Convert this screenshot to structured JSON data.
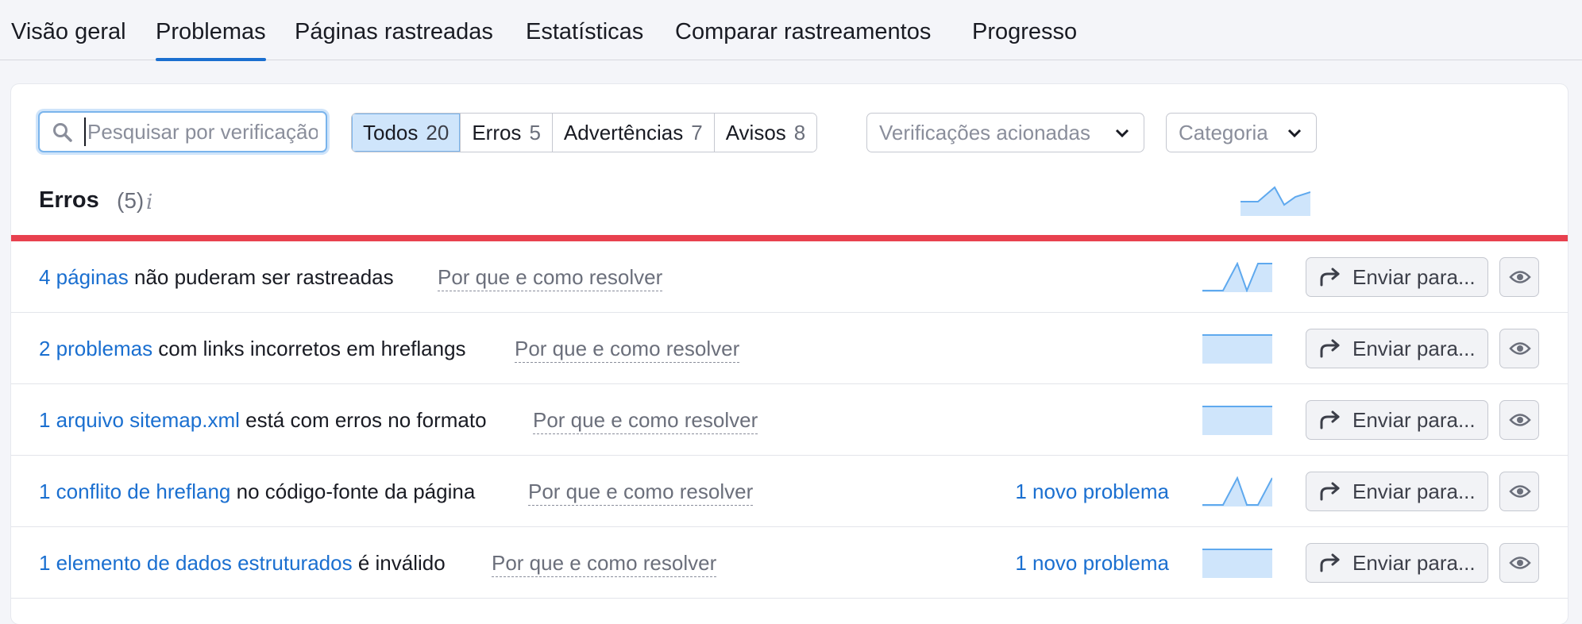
{
  "tabs": [
    {
      "label": "Visão geral",
      "active": false
    },
    {
      "label": "Problemas",
      "active": true
    },
    {
      "label": "Páginas rastreadas",
      "active": false
    },
    {
      "label": "Estatísticas",
      "active": false
    },
    {
      "label": "Comparar rastreamentos",
      "active": false
    },
    {
      "label": "Progresso",
      "active": false
    }
  ],
  "search": {
    "placeholder": "Pesquisar por verificação",
    "value": ""
  },
  "filters": [
    {
      "label": "Todos",
      "count": "20",
      "active": true
    },
    {
      "label": "Erros",
      "count": "5",
      "active": false
    },
    {
      "label": "Advertências",
      "count": "7",
      "active": false
    },
    {
      "label": "Avisos",
      "count": "8",
      "active": false
    }
  ],
  "dropdowns": {
    "checks": "Verificações acionadas",
    "category": "Categoria"
  },
  "section": {
    "title": "Erros",
    "count": "(5)",
    "info_icon": "i"
  },
  "colors": {
    "accent": "#1a6fd0",
    "error": "#e8414f",
    "spark_fill": "#cfe5fb",
    "spark_line": "#5fa9ee"
  },
  "why_label": "Por que e como resolver",
  "send_label": "Enviar para...",
  "rows": [
    {
      "link": "4 páginas",
      "text": " não puderam ser rastreadas",
      "new": ""
    },
    {
      "link": "2 problemas",
      "text": " com links incorretos em hreflangs",
      "new": ""
    },
    {
      "link": "1 arquivo sitemap.xml",
      "text": " está com erros no formato",
      "new": ""
    },
    {
      "link": "1 conflito de hreflang",
      "text": " no código-fonte da página",
      "new": "1 novo problema"
    },
    {
      "link": "1 elemento de dados estruturados",
      "text": " é inválido",
      "new": "1 novo problema"
    }
  ]
}
